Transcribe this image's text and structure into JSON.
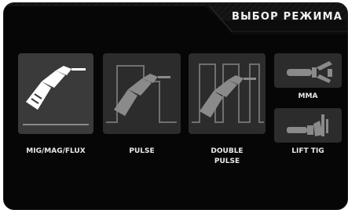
{
  "header": {
    "title": "ВЫБОР РЕЖИМА"
  },
  "modes": [
    {
      "label": "MIG/MAG/FLUX",
      "icon": "mig-torch-icon",
      "selected": true
    },
    {
      "label": "PULSE",
      "icon": "pulse-torch-icon",
      "selected": false
    },
    {
      "label_line1": "DOUBLE",
      "label_line2": "PULSE",
      "icon": "double-pulse-torch-icon",
      "selected": false
    },
    {
      "label": "MMA",
      "icon": "electrode-holder-icon",
      "selected": false
    },
    {
      "label": "LIFT TIG",
      "icon": "tig-torch-icon",
      "selected": false
    }
  ],
  "colors": {
    "background": "#060606",
    "tile": "#2c2c2c",
    "tile_active": "#3a3a3a",
    "icon_active": "#ffffff",
    "icon_inactive": "#8a8a8a",
    "pulse_line": "#707070"
  }
}
